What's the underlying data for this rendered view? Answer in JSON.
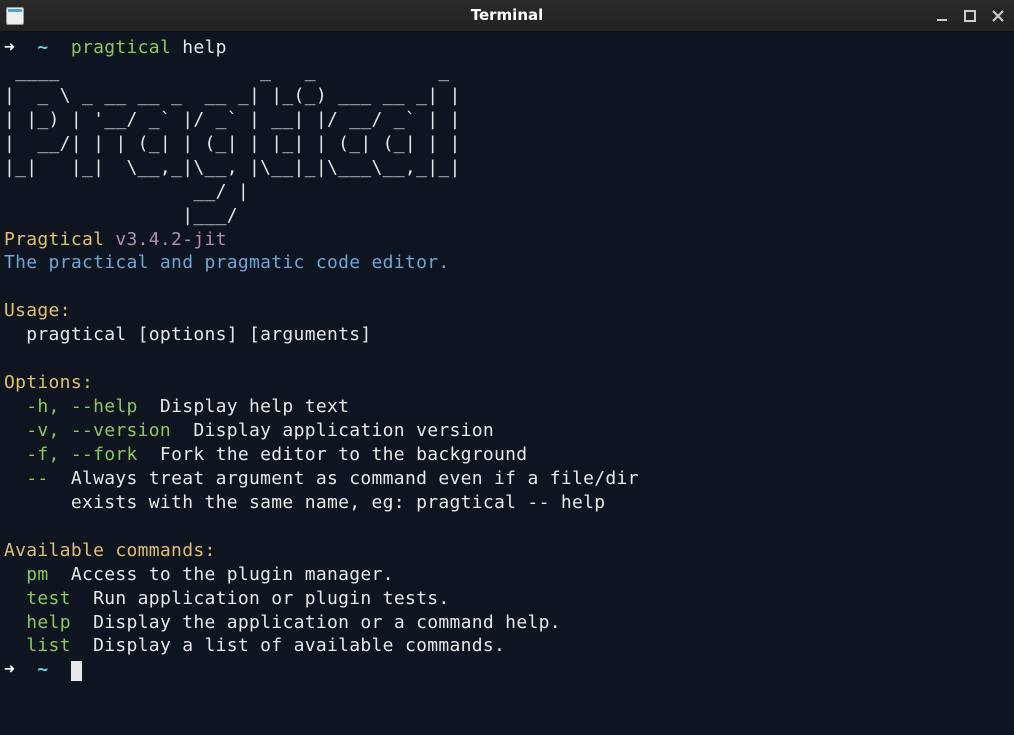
{
  "window": {
    "title": "Terminal"
  },
  "prompt": {
    "arrow": "➜",
    "tilde": "~",
    "command": "pragtical",
    "arg": "help"
  },
  "ascii_art": " ____                  _   _           _\n|  _ \\ _ __ __ _  __ _| |_(_) ___ __ _| |\n| |_) | '__/ _` |/ _` | __| |/ __/ _` | |\n|  __/| | | (_| | (_| | |_| | (_| (_| | |\n|_|   |_|  \\__,_|\\__, |\\__|_|\\___\\__,_|_|\n                 __/ |\n                |___/",
  "app": {
    "name": "Pragtical",
    "version": "v3.4.2-jit",
    "tagline": "The practical and pragmatic code editor."
  },
  "usage": {
    "header": "Usage:",
    "line": "  pragtical [options] [arguments]"
  },
  "options": {
    "header": "Options:",
    "items": [
      {
        "flag": "-h, --help",
        "desc": "  Display help text"
      },
      {
        "flag": "-v, --version",
        "desc": "  Display application version"
      },
      {
        "flag": "-f, --fork",
        "desc": "  Fork the editor to the background"
      },
      {
        "flag": "--",
        "desc": "  Always treat argument as command even if a file/dir"
      }
    ],
    "continuation": "      exists with the same name, eg: pragtical -- help"
  },
  "commands": {
    "header": "Available commands:",
    "items": [
      {
        "name": "pm",
        "desc": "  Access to the plugin manager."
      },
      {
        "name": "test",
        "desc": "  Run application or plugin tests."
      },
      {
        "name": "help",
        "desc": "  Display the application or a command help."
      },
      {
        "name": "list",
        "desc": "  Display a list of available commands."
      }
    ]
  }
}
